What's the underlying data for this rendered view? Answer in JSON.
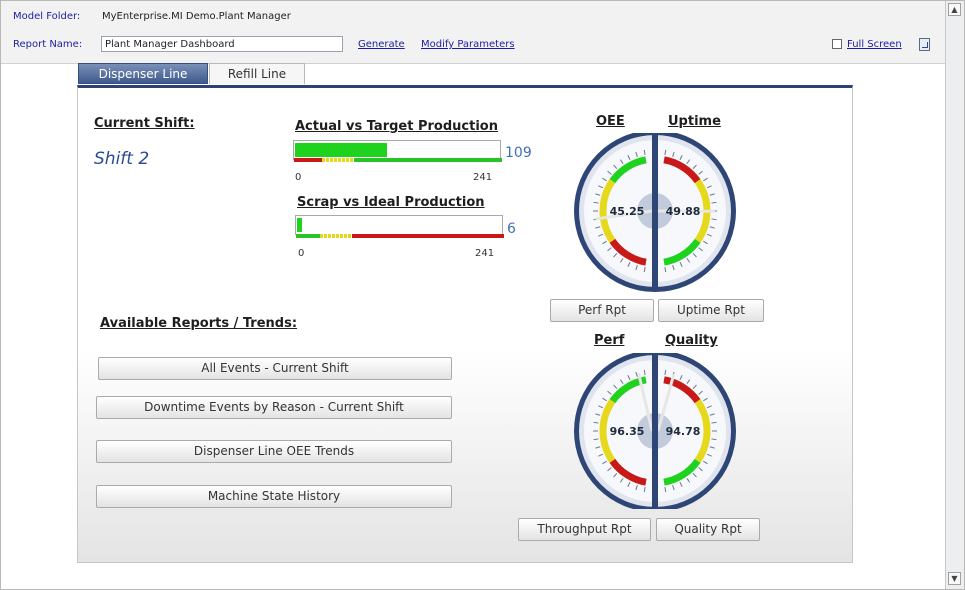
{
  "header": {
    "model_folder_label": "Model Folder:",
    "model_folder_value": "MyEnterprise.MI Demo.Plant Manager",
    "report_name_label": "Report Name:",
    "report_name_value": "Plant Manager Dashboard",
    "generate_link": "Generate",
    "modify_link": "Modify Parameters",
    "full_screen_label": "Full Screen",
    "full_screen_checked": false
  },
  "tabs": [
    {
      "label": "Dispenser Line",
      "active": true
    },
    {
      "label": "Refill Line",
      "active": false
    }
  ],
  "shift": {
    "title": "Current Shift:",
    "value": "Shift 2"
  },
  "production": {
    "title": "Actual vs Target Production",
    "value": "109",
    "value_num": 109,
    "min": "0",
    "max": "241",
    "max_num": 241
  },
  "scrap": {
    "title": "Scrap vs Ideal Production",
    "value": "6",
    "value_num": 6,
    "min": "0",
    "max": "241",
    "max_num": 241
  },
  "reports": {
    "title": "Available Reports / Trends:",
    "buttons": [
      "All Events - Current Shift",
      "Downtime Events by Reason - Current Shift",
      "Dispenser Line OEE Trends",
      "Machine State History"
    ]
  },
  "gauges": {
    "oee": {
      "title": "OEE",
      "value": "45.25",
      "value_num": 45.25
    },
    "uptime": {
      "title": "Uptime",
      "value": "49.88",
      "value_num": 49.88
    },
    "perf": {
      "title": "Perf",
      "value": "96.35",
      "value_num": 96.35
    },
    "quality": {
      "title": "Quality",
      "value": "94.78",
      "value_num": 94.78
    },
    "btn_perf_rpt": "Perf Rpt",
    "btn_uptime_rpt": "Uptime Rpt",
    "btn_throughput_rpt": "Throughput Rpt",
    "btn_quality_rpt": "Quality Rpt"
  },
  "colors": {
    "accent": "#2a4374",
    "good": "#1ed21e",
    "warn": "#e6d81a",
    "bad": "#c81818",
    "link": "#1b1fa0"
  }
}
